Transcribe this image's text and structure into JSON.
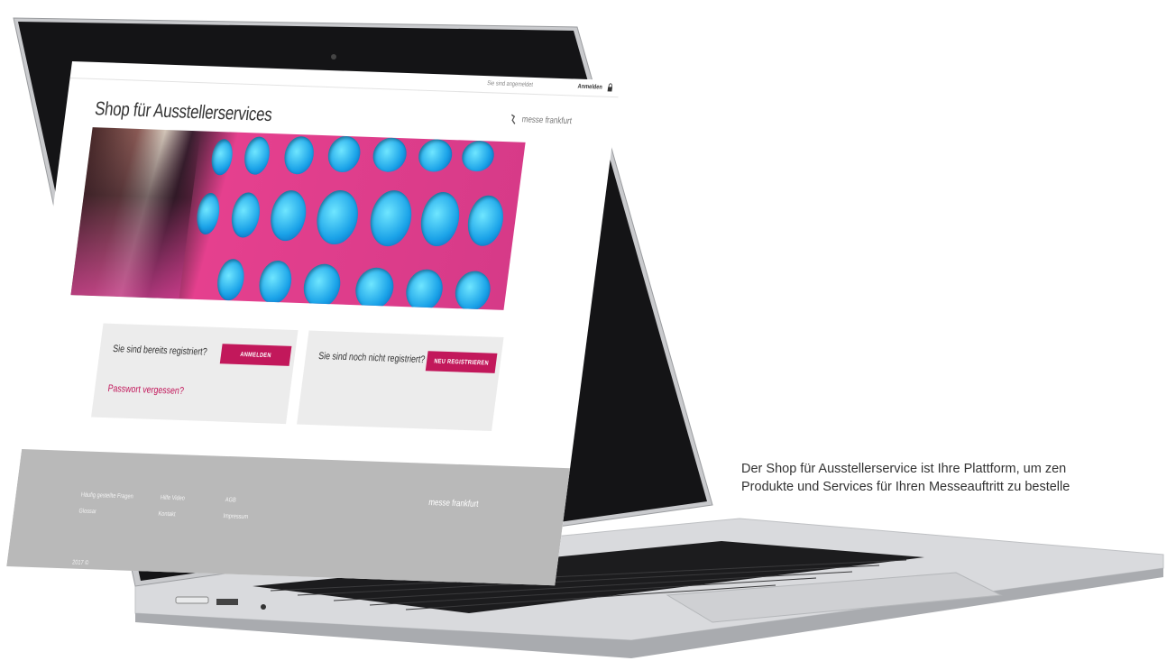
{
  "screen": {
    "topbar": {
      "language": "Sie sind angemeldet",
      "user": "Anmelden",
      "lock_icon": "lock-icon"
    },
    "title": "Shop für Ausstellerservices",
    "logo_text": "messe frankfurt",
    "cards": {
      "login": {
        "question": "Sie sind bereits registriert?",
        "button": "ANMELDEN",
        "forgot_link": "Passwort vergessen?"
      },
      "register": {
        "question": "Sie sind noch nicht registriert?",
        "button": "NEU REGISTRIEREN"
      }
    },
    "footer": {
      "col1": [
        "Häufig gestellte Fragen",
        "Glossar"
      ],
      "col2": [
        "Hilfe Video",
        "Kontakt"
      ],
      "col3": [
        "AGB",
        "Impressum"
      ],
      "copyright": "2017 ©",
      "logo_text": "messe frankfurt"
    }
  },
  "caption": {
    "line1": "Der Shop für Ausstellerservice ist Ihre Plattform, um zen",
    "line2": "Produkte und Services für Ihren Messeauftritt zu bestelle"
  },
  "colors": {
    "accent": "#c2185b",
    "footer_bg": "#b9b9b9",
    "card_bg": "#ececec"
  }
}
